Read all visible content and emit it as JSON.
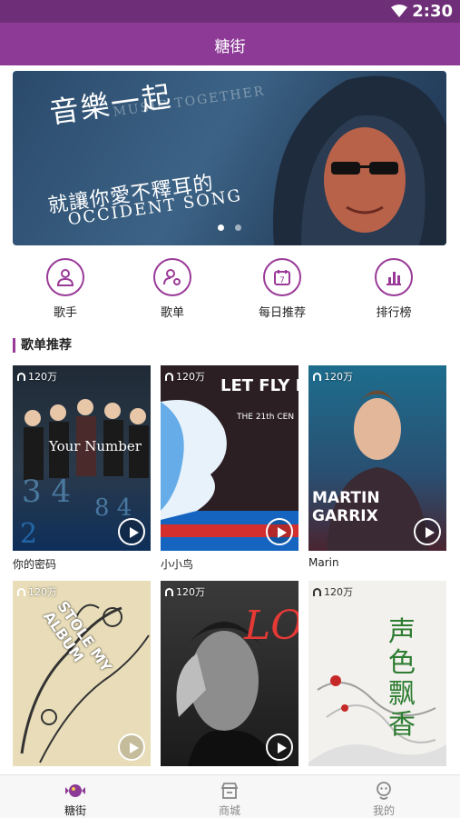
{
  "status_bar": {
    "time": "2:30",
    "wifi_icon": "wifi-icon"
  },
  "app_bar": {
    "title": "糖街"
  },
  "banner": {
    "headline": "音樂一起",
    "english_top": "MUSIC TOGETHER",
    "line2": "就讓你愛不釋耳的",
    "english_bottom": "OCCIDENT SONG",
    "pages": 2,
    "active_page": 1
  },
  "quick_links": [
    {
      "label": "歌手",
      "icon": "singer-icon"
    },
    {
      "label": "歌单",
      "icon": "playlist-icon"
    },
    {
      "label": "每日推荐",
      "icon": "calendar-icon"
    },
    {
      "label": "排行榜",
      "icon": "chart-icon"
    }
  ],
  "section": {
    "title": "歌单推荐"
  },
  "playlists": [
    {
      "count": "120万",
      "name": "你的密码",
      "cover_text": "Your Number"
    },
    {
      "count": "120万",
      "name": "小小鸟",
      "cover_text": "LET FLY BI",
      "cover_sub": "THE 21th CEN"
    },
    {
      "count": "120万",
      "name": "Marin",
      "cover_text": "MARTIN GARRIX"
    },
    {
      "count": "120万",
      "name": "",
      "cover_text": "STOLE MY ALBUM"
    },
    {
      "count": "120万",
      "name": "",
      "cover_text": "LO"
    },
    {
      "count": "120万",
      "name": "",
      "cover_text": "声色飘香"
    }
  ],
  "bottom_nav": [
    {
      "label": "糖街",
      "icon": "candy-icon",
      "active": true
    },
    {
      "label": "商城",
      "icon": "shop-icon",
      "active": false
    },
    {
      "label": "我的",
      "icon": "profile-icon",
      "active": false
    }
  ],
  "colors": {
    "primary": "#8d3a96",
    "status_bar": "#6f2f78",
    "accent": "#9a3a98"
  }
}
